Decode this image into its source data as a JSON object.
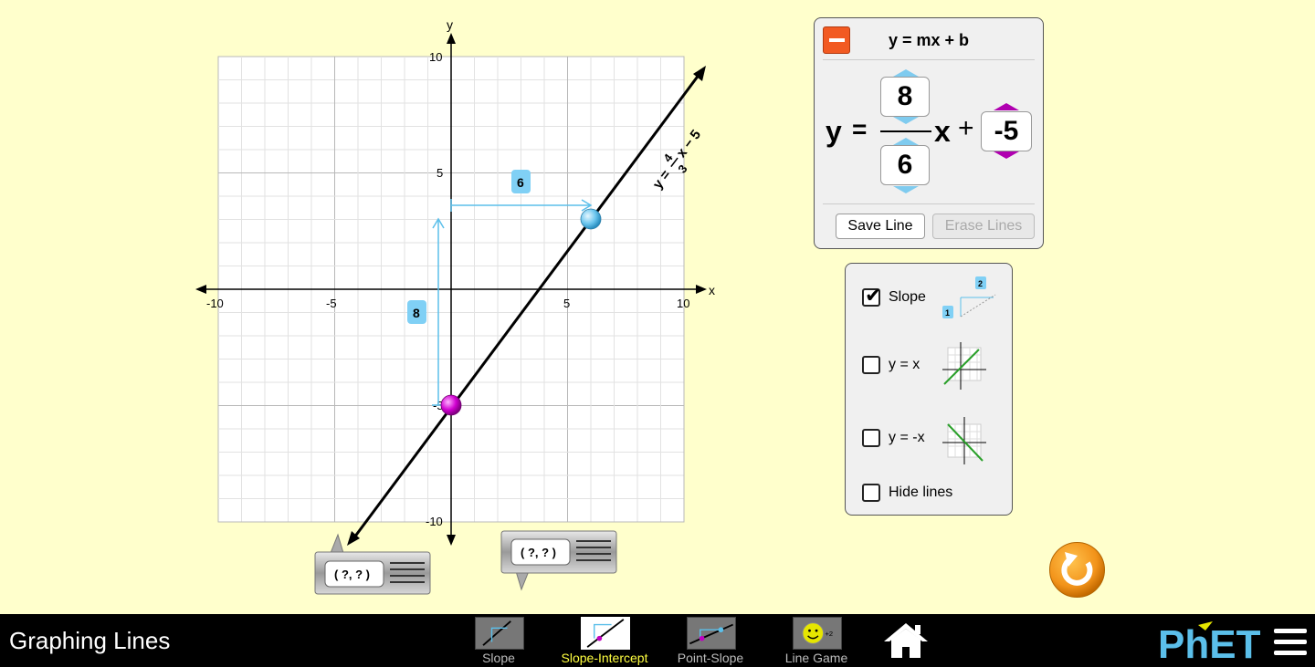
{
  "app": {
    "title": "Graphing Lines"
  },
  "graph": {
    "x_axis_label": "x",
    "y_axis_label": "y",
    "x_ticks": [
      "-10",
      "-5",
      "5",
      "10"
    ],
    "y_ticks": [
      "10",
      "5",
      "-5",
      "-10"
    ],
    "x_range": [
      -10,
      10
    ],
    "y_range": [
      -10,
      10
    ],
    "line": {
      "slope_numerator": "4",
      "slope_denominator": "3",
      "intercept": "5",
      "eq_prefix": "y = ",
      "eq_x": "x − ",
      "point1": [
        0,
        -5
      ],
      "point2": [
        6,
        3
      ]
    },
    "slope_run_label": "6",
    "slope_rise_label": "8",
    "point_tools": [
      {
        "label": "( ?, ? )"
      },
      {
        "label": "( ?, ? )"
      }
    ]
  },
  "equation_panel": {
    "title": "y = mx + b",
    "y_label": "y",
    "equals": "=",
    "numerator": "8",
    "denominator": "6",
    "x_label": "x",
    "plus": "+",
    "intercept": "-5",
    "save_line": "Save Line",
    "erase_lines": "Erase Lines"
  },
  "options_panel": {
    "items": [
      {
        "label": "Slope",
        "checked": true,
        "icon_rise": "1",
        "icon_run": "2"
      },
      {
        "label": "y = x",
        "checked": false
      },
      {
        "label": "y = -x",
        "checked": false
      },
      {
        "label": "Hide lines",
        "checked": false
      }
    ]
  },
  "navbar": {
    "tabs": [
      {
        "label": "Slope",
        "selected": false
      },
      {
        "label": "Slope-Intercept",
        "selected": true
      },
      {
        "label": "Point-Slope",
        "selected": false
      },
      {
        "label": "Line Game",
        "selected": false
      }
    ],
    "logo": "PhET"
  },
  "colors": {
    "background": "#ffffcc",
    "slope_blue": "#5bbfea",
    "intercept_magenta": "#c000c0",
    "selected_tab": "#ffff40"
  }
}
